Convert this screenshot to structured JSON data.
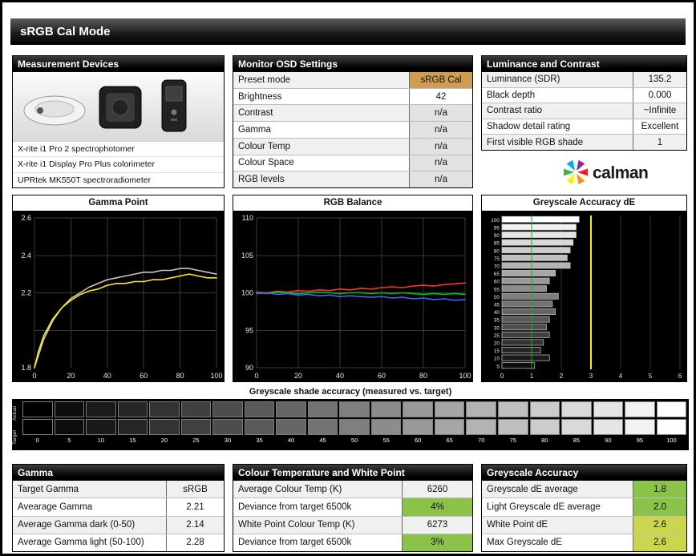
{
  "title_bar": {
    "title": "sRGB Cal Mode"
  },
  "measurement_devices": {
    "header": "Measurement Devices",
    "devices": [
      "X-rite i1 Pro 2 spectrophotomer",
      "X-rite i1 Display Pro Plus colorimeter",
      "UPRtek MK550T spectroradiometer"
    ]
  },
  "monitor_osd": {
    "header": "Monitor OSD Settings",
    "rows": [
      {
        "label": "Preset mode",
        "value": "sRGB Cal"
      },
      {
        "label": "Brightness",
        "value": "42"
      },
      {
        "label": "Contrast",
        "value": "n/a"
      },
      {
        "label": "Gamma",
        "value": "n/a"
      },
      {
        "label": "Colour Temp",
        "value": "n/a"
      },
      {
        "label": "Colour Space",
        "value": "n/a"
      },
      {
        "label": "RGB levels",
        "value": "n/a"
      }
    ]
  },
  "luminance_contrast": {
    "header": "Luminance and Contrast",
    "rows": [
      {
        "label": "Luminance (SDR)",
        "value": "135.2"
      },
      {
        "label": "Black depth",
        "value": "0.000"
      },
      {
        "label": "Contrast ratio",
        "value": "~Infinite"
      },
      {
        "label": "Shadow detail rating",
        "value": "Excellent"
      },
      {
        "label": "First visible RGB shade",
        "value": "1"
      }
    ]
  },
  "logo": {
    "text": "calman"
  },
  "chart_data": [
    {
      "type": "line",
      "title": "Gamma Point",
      "xlim": [
        0,
        100
      ],
      "ylim": [
        1.8,
        2.6
      ],
      "xticks": [
        0,
        20,
        40,
        60,
        80,
        100
      ],
      "ytick_values": [
        2.6,
        2.4,
        2.2,
        1.8
      ],
      "ytick_labels": [
        "2.6",
        "2.4",
        "2.2",
        "1.8"
      ],
      "grid_y": [
        2.0,
        2.2,
        2.4,
        2.6
      ],
      "x": [
        0,
        2,
        5,
        10,
        15,
        20,
        25,
        30,
        35,
        40,
        45,
        50,
        55,
        60,
        65,
        70,
        75,
        80,
        85,
        90,
        95,
        100
      ],
      "series": [
        {
          "name": "target",
          "color": "#c8c8c8",
          "values": [
            1.8,
            1.86,
            1.95,
            2.05,
            2.12,
            2.17,
            2.2,
            2.23,
            2.25,
            2.27,
            2.28,
            2.29,
            2.3,
            2.31,
            2.31,
            2.32,
            2.32,
            2.33,
            2.33,
            2.32,
            2.31,
            2.3
          ]
        },
        {
          "name": "measured",
          "color": "#ffe818",
          "values": [
            1.8,
            1.88,
            1.97,
            2.06,
            2.12,
            2.16,
            2.19,
            2.21,
            2.22,
            2.24,
            2.25,
            2.25,
            2.26,
            2.26,
            2.27,
            2.27,
            2.28,
            2.29,
            2.3,
            2.29,
            2.28,
            2.28
          ]
        }
      ]
    },
    {
      "type": "line",
      "title": "RGB Balance",
      "xlim": [
        0,
        100
      ],
      "ylim": [
        90,
        110
      ],
      "xticks": [
        0,
        20,
        40,
        60,
        80,
        100
      ],
      "ytick_values": [
        110,
        105,
        100,
        95,
        90
      ],
      "ytick_labels": [
        "110",
        "105",
        "100",
        "95",
        "90"
      ],
      "grid_y": [
        90,
        95,
        100,
        105,
        110
      ],
      "x": [
        0,
        5,
        10,
        15,
        20,
        25,
        30,
        35,
        40,
        45,
        50,
        55,
        60,
        65,
        70,
        75,
        80,
        85,
        90,
        95,
        100
      ],
      "series": [
        {
          "name": "red",
          "color": "#ff3232",
          "values": [
            100.1,
            100.0,
            100.2,
            100.1,
            100.3,
            100.2,
            100.4,
            100.3,
            100.5,
            100.4,
            100.6,
            100.5,
            100.7,
            100.8,
            100.7,
            100.9,
            101.0,
            100.9,
            101.1,
            101.2,
            101.3
          ]
        },
        {
          "name": "green",
          "color": "#00c800",
          "values": [
            100.0,
            99.9,
            100.1,
            100.0,
            99.9,
            100.0,
            100.1,
            100.0,
            99.9,
            100.0,
            100.0,
            99.9,
            100.0,
            99.9,
            100.0,
            99.9,
            99.8,
            99.9,
            99.8,
            99.9,
            99.8
          ]
        },
        {
          "name": "blue",
          "color": "#3c64ff",
          "values": [
            99.9,
            100.0,
            99.8,
            99.9,
            99.7,
            99.8,
            99.6,
            99.7,
            99.5,
            99.6,
            99.5,
            99.4,
            99.5,
            99.3,
            99.4,
            99.2,
            99.3,
            99.1,
            99.2,
            99.0,
            99.1
          ]
        }
      ]
    },
    {
      "type": "bar-h",
      "title": "Greyscale Accuracy dE",
      "xlim": [
        0,
        6
      ],
      "xticks": [
        0,
        1,
        2,
        3,
        4,
        5,
        6
      ],
      "categories": [
        100,
        95,
        90,
        85,
        80,
        75,
        70,
        65,
        60,
        55,
        50,
        45,
        40,
        35,
        30,
        25,
        20,
        15,
        10,
        5
      ],
      "values": [
        2.6,
        2.5,
        2.5,
        2.4,
        2.3,
        2.2,
        2.3,
        1.8,
        1.6,
        1.5,
        1.9,
        1.7,
        1.8,
        1.6,
        1.5,
        1.6,
        1.4,
        1.3,
        1.6,
        1.1
      ],
      "ref_lines": [
        {
          "x": 1,
          "color": "#00c000",
          "width": 1
        },
        {
          "x": 3,
          "color": "#ffee00",
          "width": 2
        }
      ]
    }
  ],
  "greyscale_strip": {
    "title": "Greyscale shade accuracy (measured vs. target)",
    "row_labels": [
      "Actual",
      "Target"
    ],
    "levels": [
      0,
      5,
      10,
      15,
      20,
      25,
      30,
      35,
      40,
      45,
      50,
      55,
      60,
      65,
      70,
      75,
      80,
      85,
      90,
      95,
      100
    ]
  },
  "gamma_table": {
    "header": "Gamma",
    "rows": [
      {
        "label": "Target Gamma",
        "value": "sRGB",
        "status": "none"
      },
      {
        "label": "Avearage Gamma",
        "value": "2.21",
        "status": "none"
      },
      {
        "label": "Average Gamma dark (0-50)",
        "value": "2.14",
        "status": "none"
      },
      {
        "label": "Average Gamma light (50-100)",
        "value": "2.28",
        "status": "none"
      }
    ]
  },
  "colour_temp_table": {
    "header": "Colour Temperature and White Point",
    "rows": [
      {
        "label": "Average Colour Temp (K)",
        "value": "6260",
        "status": "none"
      },
      {
        "label": "Deviance from target 6500k",
        "value": "4%",
        "status": "green"
      },
      {
        "label": "White Point Colour Temp (K)",
        "value": "6273",
        "status": "none"
      },
      {
        "label": "Deviance from target 6500k",
        "value": "3%",
        "status": "green"
      }
    ]
  },
  "greyscale_accuracy_table": {
    "header": "Greyscale Accuracy",
    "rows": [
      {
        "label": "Greyscale dE average",
        "value": "1.8",
        "status": "green"
      },
      {
        "label": "Light Greyscale dE average",
        "value": "2.0",
        "status": "green"
      },
      {
        "label": "White Point dE",
        "value": "2.6",
        "status": "yellow"
      },
      {
        "label": "Max Greyscale dE",
        "value": "2.6",
        "status": "yellow"
      }
    ]
  },
  "colors": {
    "pass_green": "#8bc34a",
    "warn_yellow": "#ccd64d",
    "preset_highlight": "#ce9d51",
    "ref_green": "#00c000",
    "ref_yellow": "#ffee00",
    "gamma_measured": "#ffe818",
    "gamma_target": "#c8c8c8",
    "rgb_red": "#ff3232",
    "rgb_green": "#00c800",
    "rgb_blue": "#3c64ff"
  }
}
